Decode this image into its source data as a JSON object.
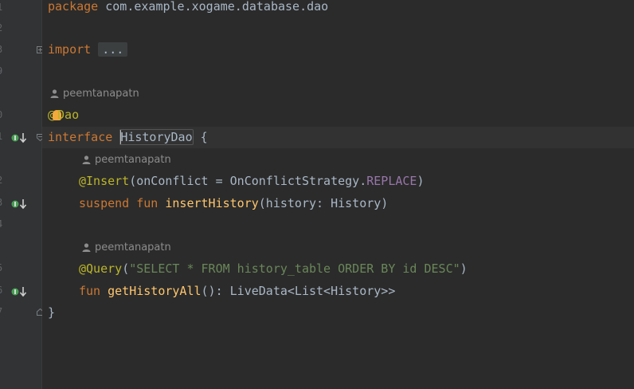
{
  "gutter": {
    "line_numbers": [
      "1",
      "2",
      "3",
      "9",
      "",
      "0",
      "1",
      "",
      "2",
      "3",
      "4",
      "",
      "5",
      "6",
      "7"
    ]
  },
  "code": {
    "package_kw": "package",
    "package_name": " com.example.xogame.database.dao",
    "import_kw": "import",
    "import_fold": "...",
    "author": "peemtanapatn",
    "dao_at": "@",
    "dao_name": "Dao",
    "interface_kw": "interface",
    "interface_name": "HistoryDao",
    "open_brace": " {",
    "insert_ann": "@Insert",
    "insert_args_open": "(onConflict = OnConflictStrategy.",
    "insert_const": "REPLACE",
    "insert_args_close": ")",
    "suspend_kw": "suspend",
    "fun_kw": "fun",
    "insert_fn": "insertHistory",
    "insert_params": "(history: History)",
    "query_ann": "@Query",
    "query_open": "(",
    "query_string": "\"SELECT * FROM history_table ORDER BY id DESC\"",
    "query_close": ")",
    "get_fn": "getHistoryAll",
    "get_sig": "(): LiveData<List<History>>",
    "close_brace": "}"
  },
  "icons": {
    "implemented": "implemented-icon",
    "person": "person-icon",
    "fold": "fold-icon"
  }
}
